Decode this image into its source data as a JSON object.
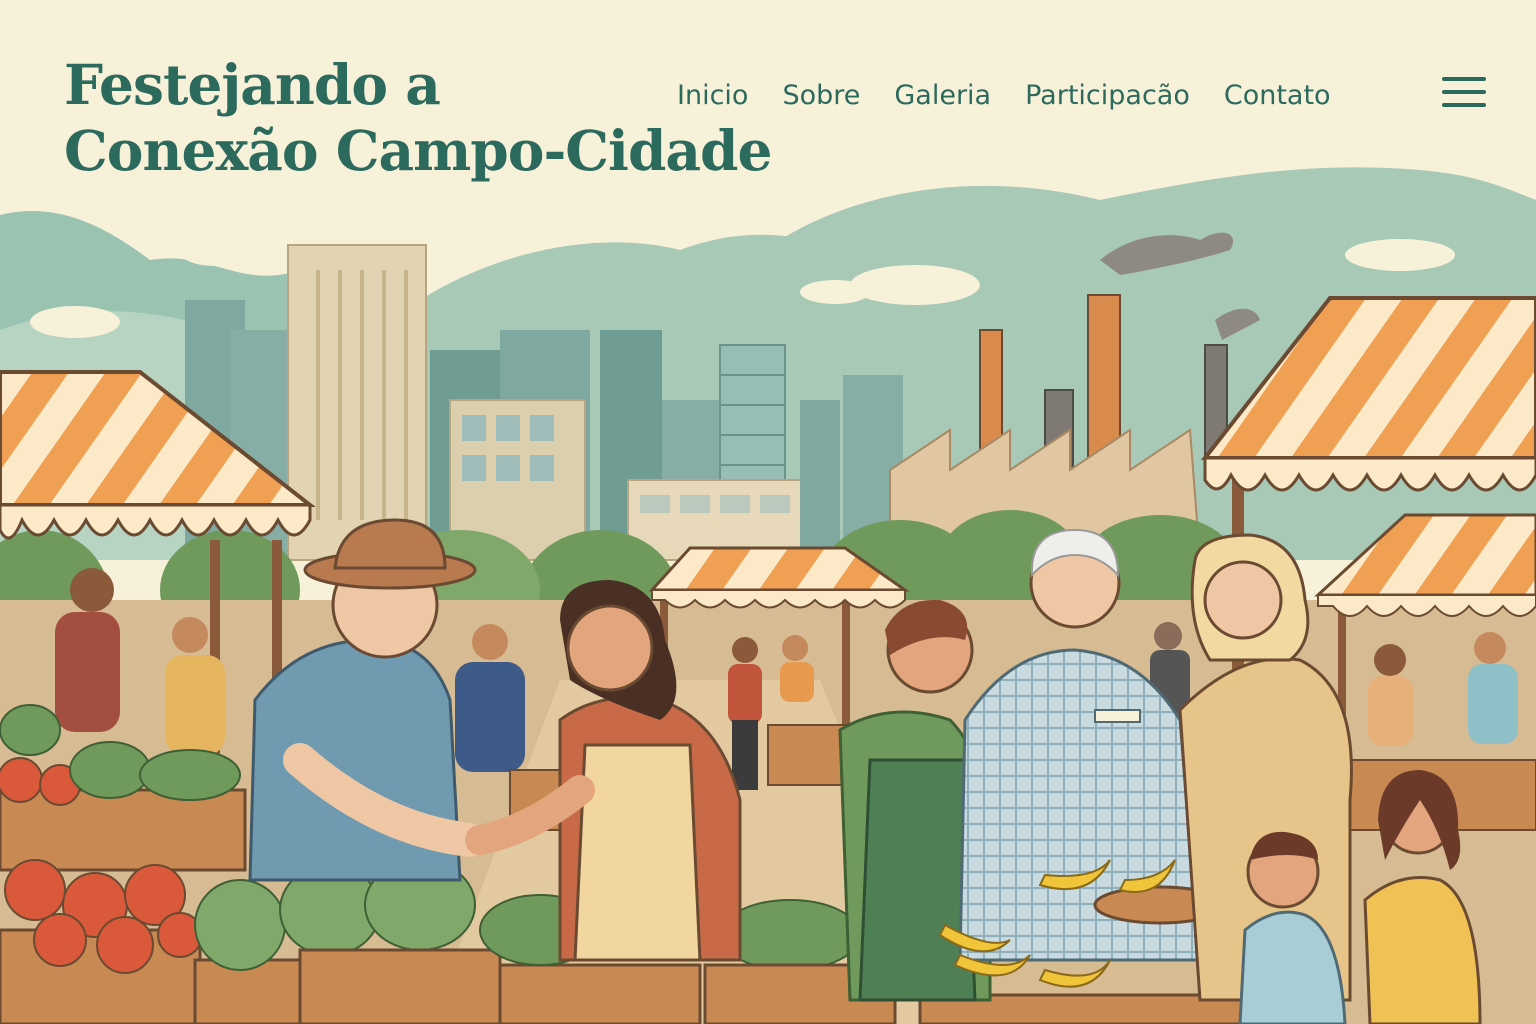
{
  "header": {
    "title_line1": "Festejando a",
    "title_line2": "Conexão Campo-Cidade"
  },
  "nav": {
    "items": [
      {
        "label": "Inicio"
      },
      {
        "label": "Sobre"
      },
      {
        "label": "Galeria"
      },
      {
        "label": "Participacão"
      },
      {
        "label": "Contato"
      }
    ],
    "menu_icon": "hamburger-menu-icon"
  },
  "colors": {
    "brand": "#2d6a5e",
    "background": "#f8f1da",
    "awning_orange": "#f0a052",
    "awning_cream": "#fbe9c8"
  }
}
